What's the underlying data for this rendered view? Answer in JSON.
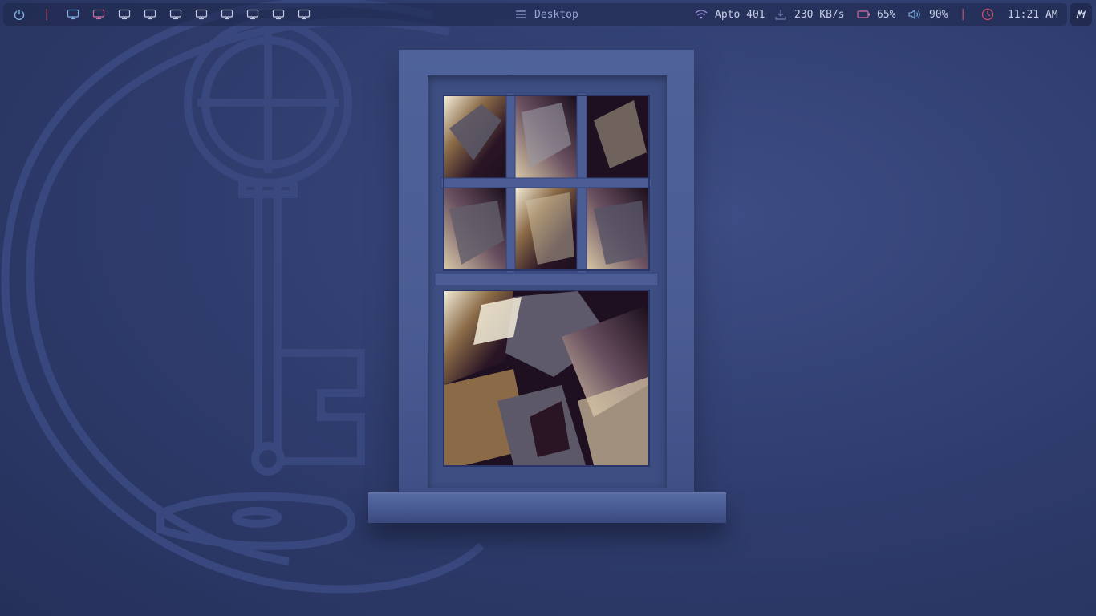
{
  "topbar": {
    "power_icon": "power-icon",
    "workspaces": [
      {
        "icon": "monitor-icon",
        "color": "#7fb0e6"
      },
      {
        "icon": "monitor-icon",
        "color": "#d26fa0"
      },
      {
        "icon": "monitor-icon",
        "color": "#c8cde4"
      },
      {
        "icon": "monitor-icon",
        "color": "#c8cde4"
      },
      {
        "icon": "monitor-icon",
        "color": "#c8cde4"
      },
      {
        "icon": "monitor-icon",
        "color": "#c8cde4"
      },
      {
        "icon": "monitor-icon",
        "color": "#c8cde4"
      },
      {
        "icon": "monitor-icon",
        "color": "#c8cde4"
      },
      {
        "icon": "monitor-icon",
        "color": "#c8cde4"
      },
      {
        "icon": "monitor-icon",
        "color": "#c8cde4"
      }
    ],
    "title": "Desktop",
    "wifi_name": "Apto 401",
    "download_speed": "230 KB/s",
    "battery": "65%",
    "volume": "90%",
    "clock": "11:21 AM",
    "colors": {
      "accent_blue": "#7fb0e6",
      "accent_pink": "#d26fa0",
      "separator": "#c8506a",
      "title": "#9aa6d8"
    }
  }
}
